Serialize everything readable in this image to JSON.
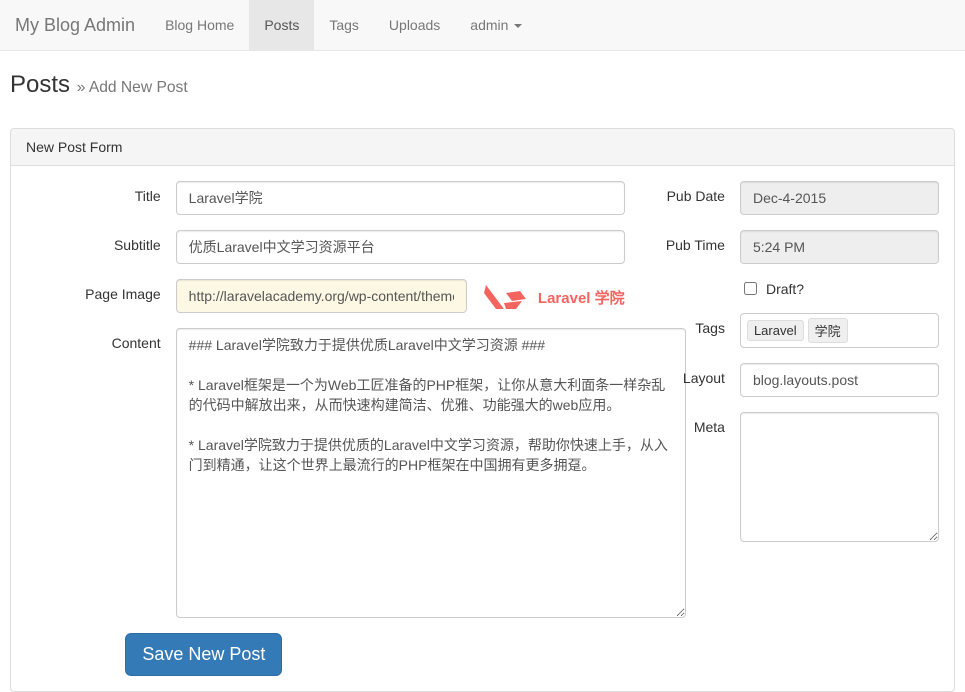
{
  "nav": {
    "brand": "My Blog Admin",
    "items": [
      {
        "label": "Blog Home",
        "active": false
      },
      {
        "label": "Posts",
        "active": true
      },
      {
        "label": "Tags",
        "active": false
      },
      {
        "label": "Uploads",
        "active": false
      }
    ],
    "user": "admin"
  },
  "header": {
    "title": "Posts",
    "subtitle": "» Add New Post"
  },
  "panel": {
    "heading": "New Post Form"
  },
  "form": {
    "labels": {
      "title": "Title",
      "subtitle": "Subtitle",
      "page_image": "Page Image",
      "content": "Content",
      "pub_date": "Pub Date",
      "pub_time": "Pub Time",
      "draft": "Draft?",
      "tags": "Tags",
      "layout": "Layout",
      "meta": "Meta"
    },
    "values": {
      "title": "Laravel学院",
      "subtitle": "优质Laravel中文学习资源平台",
      "page_image": "http://laravelacademy.org/wp-content/themes/v",
      "content": "### Laravel学院致力于提供优质Laravel中文学习资源 ###\n\n* Laravel框架是一个为Web工匠准备的PHP框架，让你从意大利面条一样杂乱的代码中解放出来，从而快速构建简洁、优雅、功能强大的web应用。\n\n* Laravel学院致力于提供优质的Laravel中文学习资源，帮助你快速上手，从入门到精通，让这个世界上最流行的PHP框架在中国拥有更多拥趸。",
      "pub_date": "Dec-4-2015",
      "pub_time": "5:24 PM",
      "draft": false,
      "layout": "blog.layouts.post",
      "meta": ""
    },
    "tags": [
      "Laravel",
      "学院"
    ],
    "thumb_label": "Laravel 学院",
    "submit": "Save New Post"
  }
}
